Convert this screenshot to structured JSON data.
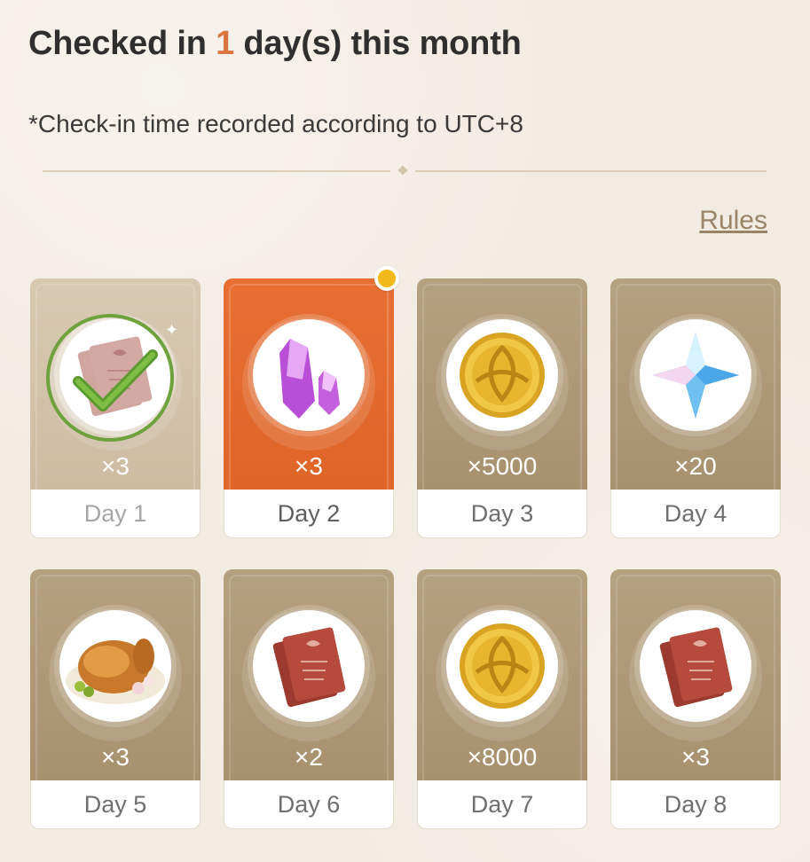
{
  "header": {
    "title_prefix": "Checked in ",
    "title_count": "1",
    "title_suffix": " day(s) this month",
    "note": "*Check-in time recorded according to UTC+8",
    "rules_label": "Rules"
  },
  "colors": {
    "accent": "#d9743f",
    "active_card": "#e86f33",
    "card": "#b5a07f",
    "claimed_card": "#d8c9b2",
    "check": "#6da23c",
    "dot": "#f0b81a"
  },
  "days": [
    {
      "label": "Day 1",
      "qty": "×3",
      "item": "hero-wit-icon",
      "state": "claimed"
    },
    {
      "label": "Day 2",
      "qty": "×3",
      "item": "crystal-icon",
      "state": "active"
    },
    {
      "label": "Day 3",
      "qty": "×5000",
      "item": "mora-icon",
      "state": "pending"
    },
    {
      "label": "Day 4",
      "qty": "×20",
      "item": "primogem-icon",
      "state": "pending"
    },
    {
      "label": "Day 5",
      "qty": "×3",
      "item": "roast-chicken-icon",
      "state": "pending"
    },
    {
      "label": "Day 6",
      "qty": "×2",
      "item": "hero-wit-icon",
      "state": "pending"
    },
    {
      "label": "Day 7",
      "qty": "×8000",
      "item": "mora-icon",
      "state": "pending"
    },
    {
      "label": "Day 8",
      "qty": "×3",
      "item": "hero-wit-icon",
      "state": "pending"
    }
  ]
}
